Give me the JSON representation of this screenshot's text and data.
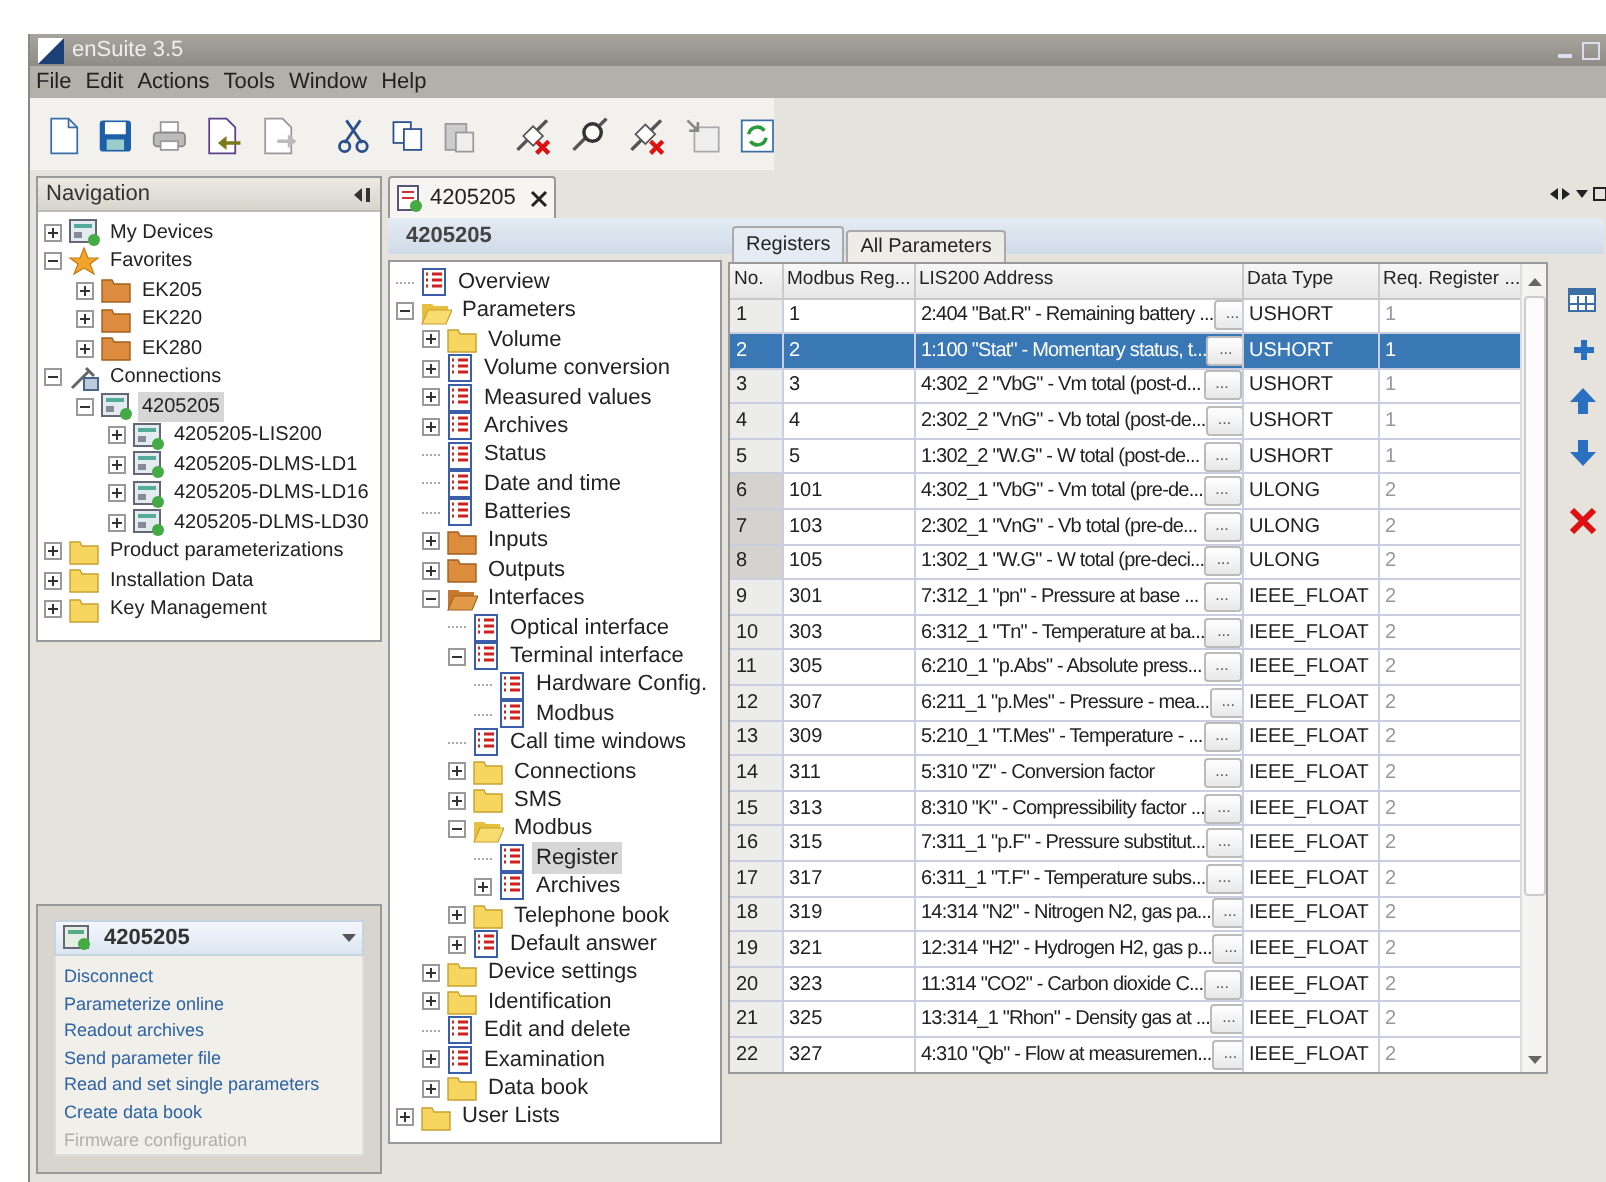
{
  "window": {
    "title": "enSuite 3.5"
  },
  "menu": [
    "File",
    "Edit",
    "Actions",
    "Tools",
    "Window",
    "Help"
  ],
  "navigation": {
    "title": "Navigation",
    "tree": [
      {
        "label": "My Devices",
        "kind": "device",
        "expanded": false,
        "selected": false
      },
      {
        "label": "Favorites",
        "kind": "star",
        "expanded": true,
        "selected": false,
        "children": [
          {
            "label": "EK205",
            "kind": "orange-folder",
            "expanded": false,
            "selected": false
          },
          {
            "label": "EK220",
            "kind": "orange-folder",
            "expanded": false,
            "selected": false
          },
          {
            "label": "EK280",
            "kind": "orange-folder",
            "expanded": false,
            "selected": false
          }
        ]
      },
      {
        "label": "Connections",
        "kind": "plug",
        "expanded": true,
        "selected": false,
        "children": [
          {
            "label": "4205205",
            "kind": "device",
            "expanded": true,
            "selected": true,
            "children": [
              {
                "label": "4205205-LIS200",
                "kind": "device",
                "expanded": false,
                "selected": false
              },
              {
                "label": "4205205-DLMS-LD1",
                "kind": "device",
                "expanded": false,
                "selected": false
              },
              {
                "label": "4205205-DLMS-LD16",
                "kind": "device",
                "expanded": false,
                "selected": false
              },
              {
                "label": "4205205-DLMS-LD30",
                "kind": "device",
                "expanded": false,
                "selected": false
              }
            ]
          }
        ]
      },
      {
        "label": "Product parameterizations",
        "kind": "folder",
        "expanded": false,
        "selected": false
      },
      {
        "label": "Installation Data",
        "kind": "folder",
        "expanded": false,
        "selected": false
      },
      {
        "label": "Key Management",
        "kind": "folder",
        "expanded": false,
        "selected": false
      }
    ]
  },
  "actions": {
    "title": "4205205",
    "items": [
      {
        "label": "Disconnect",
        "disabled": false
      },
      {
        "label": "Parameterize online",
        "disabled": false
      },
      {
        "label": "Readout archives",
        "disabled": false
      },
      {
        "label": "Send parameter file",
        "disabled": false
      },
      {
        "label": "Read and set single parameters",
        "disabled": false
      },
      {
        "label": "Create data book",
        "disabled": false
      },
      {
        "label": "Firmware configuration",
        "disabled": true
      }
    ]
  },
  "editor": {
    "tab": "4205205",
    "header": "4205205",
    "tree": [
      {
        "label": "Overview",
        "kind": "list",
        "selected": false
      },
      {
        "label": "Parameters",
        "kind": "folder",
        "expanded": true,
        "selected": false,
        "children": [
          {
            "label": "Volume",
            "kind": "folder",
            "expanded": false,
            "selected": false
          },
          {
            "label": "Volume conversion",
            "kind": "list",
            "expanded": false,
            "selected": false
          },
          {
            "label": "Measured values",
            "kind": "list",
            "expanded": false,
            "selected": false
          },
          {
            "label": "Archives",
            "kind": "list",
            "expanded": false,
            "selected": false
          },
          {
            "label": "Status",
            "kind": "list",
            "selected": false
          },
          {
            "label": "Date and time",
            "kind": "list",
            "selected": false
          },
          {
            "label": "Batteries",
            "kind": "list",
            "selected": false
          },
          {
            "label": "Inputs",
            "kind": "orange-folder",
            "expanded": false,
            "selected": false
          },
          {
            "label": "Outputs",
            "kind": "orange-folder",
            "expanded": false,
            "selected": false
          },
          {
            "label": "Interfaces",
            "kind": "orange-folder",
            "expanded": true,
            "selected": false,
            "children": [
              {
                "label": "Optical interface",
                "kind": "list",
                "selected": false
              },
              {
                "label": "Terminal interface",
                "kind": "list",
                "expanded": true,
                "selected": false,
                "children": [
                  {
                    "label": "Hardware Config.",
                    "kind": "list",
                    "selected": false
                  },
                  {
                    "label": "Modbus",
                    "kind": "list",
                    "selected": false
                  }
                ]
              },
              {
                "label": "Call time windows",
                "kind": "list",
                "selected": false
              },
              {
                "label": "Connections",
                "kind": "folder",
                "expanded": false,
                "selected": false
              },
              {
                "label": "SMS",
                "kind": "folder",
                "expanded": false,
                "selected": false
              },
              {
                "label": "Modbus",
                "kind": "folder",
                "expanded": true,
                "selected": false,
                "children": [
                  {
                    "label": "Register",
                    "kind": "list",
                    "selected": true
                  },
                  {
                    "label": "Archives",
                    "kind": "list",
                    "expanded": false,
                    "selected": false
                  }
                ]
              },
              {
                "label": "Telephone book",
                "kind": "folder",
                "expanded": false,
                "selected": false
              },
              {
                "label": "Default answer",
                "kind": "list",
                "expanded": false,
                "selected": false
              }
            ]
          },
          {
            "label": "Device settings",
            "kind": "folder",
            "expanded": false,
            "selected": false
          },
          {
            "label": "Identification",
            "kind": "folder",
            "expanded": false,
            "selected": false
          },
          {
            "label": "Edit and delete",
            "kind": "list",
            "selected": false
          },
          {
            "label": "Examination",
            "kind": "list",
            "expanded": false,
            "selected": false
          },
          {
            "label": "Data book",
            "kind": "folder",
            "expanded": false,
            "selected": false
          }
        ]
      },
      {
        "label": "User Lists",
        "kind": "folder",
        "expanded": false,
        "selected": false
      }
    ]
  },
  "subtabs": [
    {
      "label": "Registers",
      "selected": true
    },
    {
      "label": "All Parameters",
      "selected": false
    }
  ],
  "table": {
    "columns": [
      "No.",
      "Modbus Reg...",
      "LIS200 Address",
      "Data Type",
      "Req. Register ..."
    ],
    "rows": [
      {
        "no": "1",
        "modbus": "1",
        "address": "2:404 \"Bat.R\" - Remaining battery ...",
        "type": "USHORT",
        "count": "1",
        "selected": false,
        "marked": false
      },
      {
        "no": "2",
        "modbus": "2",
        "address": "1:100 \"Stat\" - Momentary status, t...",
        "type": "USHORT",
        "count": "1",
        "selected": true,
        "marked": false
      },
      {
        "no": "3",
        "modbus": "3",
        "address": "4:302_2 \"VbG\" - Vm total (post-d...",
        "type": "USHORT",
        "count": "1",
        "selected": false,
        "marked": false
      },
      {
        "no": "4",
        "modbus": "4",
        "address": "2:302_2 \"VnG\" - Vb total (post-de...",
        "type": "USHORT",
        "count": "1",
        "selected": false,
        "marked": false
      },
      {
        "no": "5",
        "modbus": "5",
        "address": "1:302_2 \"W.G\" - W total (post-de...",
        "type": "USHORT",
        "count": "1",
        "selected": false,
        "marked": false
      },
      {
        "no": "6",
        "modbus": "101",
        "address": "4:302_1 \"VbG\" - Vm total (pre-de...",
        "type": "ULONG",
        "count": "2",
        "selected": false,
        "marked": true
      },
      {
        "no": "7",
        "modbus": "103",
        "address": "2:302_1 \"VnG\" - Vb total (pre-de...",
        "type": "ULONG",
        "count": "2",
        "selected": false,
        "marked": true
      },
      {
        "no": "8",
        "modbus": "105",
        "address": "1:302_1 \"W.G\" - W total (pre-deci...",
        "type": "ULONG",
        "count": "2",
        "selected": false,
        "marked": true
      },
      {
        "no": "9",
        "modbus": "301",
        "address": "7:312_1 \"pn\" - Pressure at base ...",
        "type": "IEEE_FLOAT",
        "count": "2",
        "selected": false,
        "marked": false
      },
      {
        "no": "10",
        "modbus": "303",
        "address": "6:312_1 \"Tn\" - Temperature at ba...",
        "type": "IEEE_FLOAT",
        "count": "2",
        "selected": false,
        "marked": false
      },
      {
        "no": "11",
        "modbus": "305",
        "address": "6:210_1 \"p.Abs\" - Absolute press...",
        "type": "IEEE_FLOAT",
        "count": "2",
        "selected": false,
        "marked": false
      },
      {
        "no": "12",
        "modbus": "307",
        "address": "6:211_1 \"p.Mes\" - Pressure - mea...",
        "type": "IEEE_FLOAT",
        "count": "2",
        "selected": false,
        "marked": false
      },
      {
        "no": "13",
        "modbus": "309",
        "address": "5:210_1 \"T.Mes\" - Temperature - ...",
        "type": "IEEE_FLOAT",
        "count": "2",
        "selected": false,
        "marked": false
      },
      {
        "no": "14",
        "modbus": "311",
        "address": "5:310 \"Z\" - Conversion factor",
        "type": "IEEE_FLOAT",
        "count": "2",
        "selected": false,
        "marked": false
      },
      {
        "no": "15",
        "modbus": "313",
        "address": "8:310 \"K\" - Compressibility factor ...",
        "type": "IEEE_FLOAT",
        "count": "2",
        "selected": false,
        "marked": false
      },
      {
        "no": "16",
        "modbus": "315",
        "address": "7:311_1 \"p.F\" - Pressure substitut...",
        "type": "IEEE_FLOAT",
        "count": "2",
        "selected": false,
        "marked": false
      },
      {
        "no": "17",
        "modbus": "317",
        "address": "6:311_1 \"T.F\" - Temperature subs...",
        "type": "IEEE_FLOAT",
        "count": "2",
        "selected": false,
        "marked": false
      },
      {
        "no": "18",
        "modbus": "319",
        "address": "14:314 \"N2\" - Nitrogen N2, gas pa...",
        "type": "IEEE_FLOAT",
        "count": "2",
        "selected": false,
        "marked": false
      },
      {
        "no": "19",
        "modbus": "321",
        "address": "12:314 \"H2\" - Hydrogen H2, gas p...",
        "type": "IEEE_FLOAT",
        "count": "2",
        "selected": false,
        "marked": false
      },
      {
        "no": "20",
        "modbus": "323",
        "address": "11:314 \"CO2\" - Carbon dioxide C...",
        "type": "IEEE_FLOAT",
        "count": "2",
        "selected": false,
        "marked": false
      },
      {
        "no": "21",
        "modbus": "325",
        "address": "13:314_1 \"Rhon\" - Density gas at ...",
        "type": "IEEE_FLOAT",
        "count": "2",
        "selected": false,
        "marked": false
      },
      {
        "no": "22",
        "modbus": "327",
        "address": "4:310 \"Qb\" - Flow at measuremen...",
        "type": "IEEE_FLOAT",
        "count": "2",
        "selected": false,
        "marked": false
      }
    ],
    "button_text": "..."
  }
}
